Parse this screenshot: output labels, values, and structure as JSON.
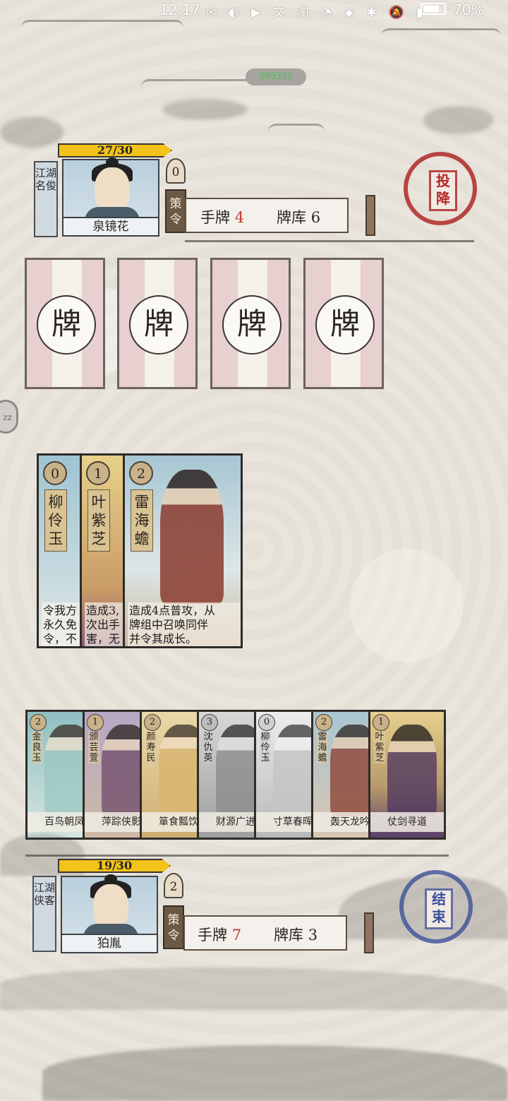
{
  "status_bar": {
    "time": "12:17",
    "icons": "✉ ◐ ▶ 文 淘 ◔ ◉ ✱ 🔕 ▮",
    "battery": "70%"
  },
  "speed_pill": "G9933S",
  "opponent": {
    "hp": "27/30",
    "title": "江湖名俊",
    "name": "泉镜花",
    "strategy_points": "0",
    "strategy_label": "策令",
    "hand_label": "手牌",
    "hand_count": "4",
    "deck_label": "牌库",
    "deck_count": "6",
    "surrender_label": "投降"
  },
  "face_down_cards": [
    "牌",
    "牌",
    "牌",
    "牌"
  ],
  "side_handle": "zz",
  "played_cards": [
    {
      "cost": "0",
      "name": "柳伶玉",
      "desc": "令我方\n永久免\n令，不"
    },
    {
      "cost": "1",
      "name": "叶紫芝",
      "desc": "造成3,\n次出手\n害，无"
    },
    {
      "cost": "2",
      "name": "雷海蟾",
      "desc": "造成4点普攻，从\n牌组中召唤同伴\n并令其成长。"
    }
  ],
  "hand_cards": [
    {
      "cost": "2",
      "name": "金良玉",
      "skill": "百鸟朝凤"
    },
    {
      "cost": "1",
      "name": "颁芸萱",
      "skill": "萍踪侠影"
    },
    {
      "cost": "2",
      "name": "颜寿民",
      "skill": "箪食瓢饮"
    },
    {
      "cost": "3",
      "name": "沈仇英",
      "skill": "财源广进"
    },
    {
      "cost": "0",
      "name": "柳伶玉",
      "skill": "寸草春晖"
    },
    {
      "cost": "2",
      "name": "雷海蟾",
      "skill": "轰天龙吟"
    },
    {
      "cost": "1",
      "name": "叶紫芝",
      "skill": "仗剑寻道"
    }
  ],
  "player": {
    "hp": "19/30",
    "title": "江湖侠客",
    "name": "狛胤",
    "strategy_points": "2",
    "strategy_label": "策令",
    "hand_label": "手牌",
    "hand_count": "7",
    "deck_label": "牌库",
    "deck_count": "3",
    "end_turn_label": "结束"
  },
  "colors": {
    "hp_yellow": "#f2c31b",
    "stamp_red": "#b32828",
    "stamp_blue": "#3b4f9c",
    "count_red": "#c0392b"
  }
}
